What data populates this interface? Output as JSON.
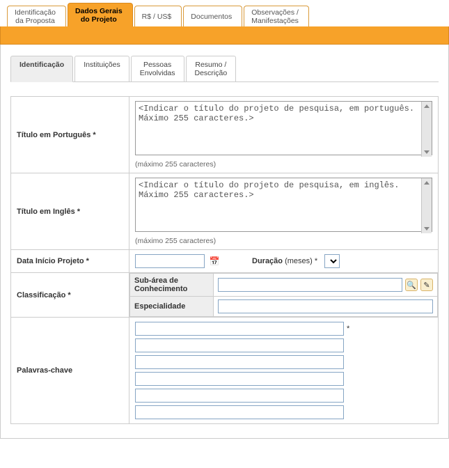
{
  "top_tabs": {
    "t1": "Identificação\nda Proposta",
    "t2": "Dados Gerais\ndo Projeto",
    "t3": "R$ / US$",
    "t4": "Documentos",
    "t5": "Observações /\nManifestações"
  },
  "sub_tabs": {
    "s1": "Identificação",
    "s2": "Instituições",
    "s3": "Pessoas\nEnvolvidas",
    "s4": "Resumo /\nDescrição"
  },
  "labels": {
    "titulo_pt": "Título em Português *",
    "titulo_en": "Título em Inglês *",
    "data_inicio": "Data Início Projeto *",
    "duracao": "Duração",
    "duracao_unit": "(meses) *",
    "classificacao": "Classificação *",
    "subarea": "Sub-área de Conhecimento",
    "especialidade": "Especialidade",
    "palavras": "Palavras-chave"
  },
  "values": {
    "titulo_pt": "<Indicar o título do projeto de pesquisa, em português. Máximo 255 caracteres.>",
    "titulo_en": "<Indicar o título do projeto de pesquisa, em inglês. Máximo 255 caracteres.>",
    "data_inicio": "",
    "duracao_sel": "",
    "subarea": "",
    "especialidade": "",
    "kw": [
      "",
      "",
      "",
      "",
      "",
      ""
    ]
  },
  "hints": {
    "max255": "(máximo 255 caracteres)"
  },
  "icons": {
    "calendar": "📅",
    "search": "🔍",
    "edit": "✎"
  },
  "markers": {
    "req": "*"
  }
}
